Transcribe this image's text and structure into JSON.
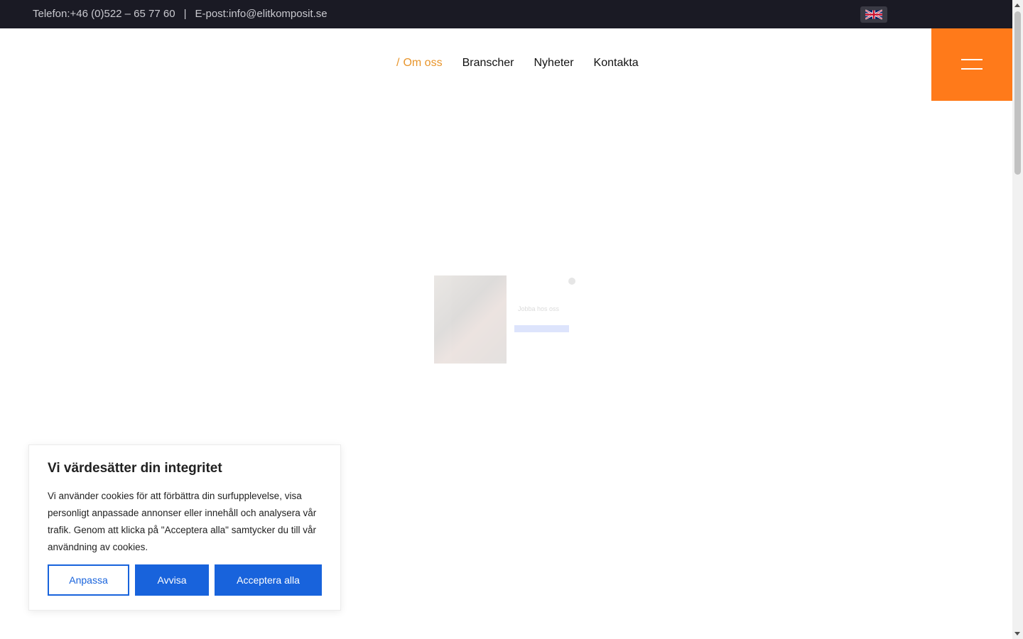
{
  "topbar": {
    "phone": "Telefon:+46 (0)522 – 65 77 60",
    "separator": "|",
    "email": "E-post:info@elitkomposit.se",
    "language_icon": "uk-flag-icon"
  },
  "nav": {
    "slash": "/",
    "items": [
      {
        "label": "Om oss"
      },
      {
        "label": "Branscher"
      },
      {
        "label": "Nyheter"
      },
      {
        "label": "Kontakta"
      }
    ],
    "menu_icon": "hamburger-icon"
  },
  "popup": {
    "title": "Jobba hos oss"
  },
  "cookie": {
    "title": "Vi värdesätter din integritet",
    "text": "Vi använder cookies för att förbättra din surfupplevelse, visa personligt anpassade annonser eller innehåll och analysera vår trafik. Genom att klicka på \"Acceptera alla\" samtycker du till vår användning av cookies.",
    "customize_label": "Anpassa",
    "reject_label": "Avvisa",
    "accept_label": "Acceptera alla"
  },
  "colors": {
    "accent": "#ff7a1a",
    "nav_active": "#e8952b",
    "topbar_bg": "#1a1a24",
    "button_blue": "#1863dc"
  }
}
